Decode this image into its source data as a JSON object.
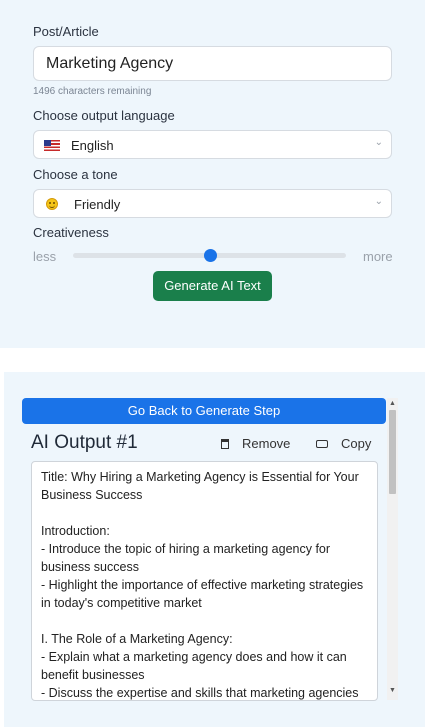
{
  "form": {
    "post_label": "Post/Article",
    "post_value": "Marketing Agency",
    "chars_remaining": "1496 characters remaining",
    "language_label": "Choose output language",
    "language_value": "English",
    "language_icon": "us-flag-icon",
    "tone_label": "Choose a tone",
    "tone_value": "Friendly",
    "tone_icon": "smiley-face-icon",
    "creativeness_label": "Creativeness",
    "slider_min_label": "less",
    "slider_max_label": "more",
    "creativeness_level": 0.5,
    "generate_button": "Generate AI Text"
  },
  "output": {
    "back_button": "Go Back to Generate Step",
    "title": "AI Output #1",
    "remove_label": "Remove",
    "copy_label": "Copy",
    "text": "Title: Why Hiring a Marketing Agency is Essential for Your Business Success\n\nIntroduction:\n- Introduce the topic of hiring a marketing agency for business success\n- Highlight the importance of effective marketing strategies in today's competitive market\n\nI. The Role of a Marketing Agency:\n- Explain what a marketing agency does and how it can benefit businesses\n- Discuss the expertise and skills that marketing agencies"
  },
  "colors": {
    "panel_bg": "#eef6fc",
    "primary_blue": "#1a73e8",
    "generate_green": "#1a7f4b"
  }
}
